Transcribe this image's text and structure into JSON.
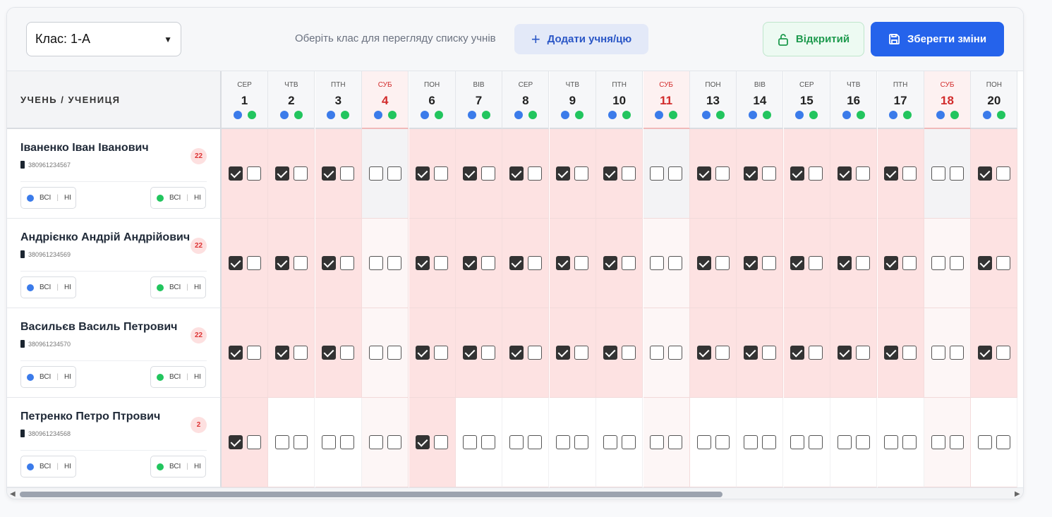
{
  "toolbar": {
    "class_select_value": "Клас: 1-А",
    "hint": "Оберіть клас для перегляду списку учнів",
    "add_label": "Додати учня/цю",
    "open_label": "Відкритий",
    "save_label": "Зберегти зміни"
  },
  "table": {
    "student_header": "УЧЕНЬ / УЧЕНИЦЯ",
    "days": [
      {
        "dow": "СЕР",
        "num": "1",
        "weekend": false
      },
      {
        "dow": "ЧТВ",
        "num": "2",
        "weekend": false
      },
      {
        "dow": "ПТН",
        "num": "3",
        "weekend": false
      },
      {
        "dow": "СУБ",
        "num": "4",
        "weekend": true
      },
      {
        "dow": "ПОН",
        "num": "6",
        "weekend": false
      },
      {
        "dow": "ВІВ",
        "num": "7",
        "weekend": false
      },
      {
        "dow": "СЕР",
        "num": "8",
        "weekend": false
      },
      {
        "dow": "ЧТВ",
        "num": "9",
        "weekend": false
      },
      {
        "dow": "ПТН",
        "num": "10",
        "weekend": false
      },
      {
        "dow": "СУБ",
        "num": "11",
        "weekend": true
      },
      {
        "dow": "ПОН",
        "num": "13",
        "weekend": false
      },
      {
        "dow": "ВІВ",
        "num": "14",
        "weekend": false
      },
      {
        "dow": "СЕР",
        "num": "15",
        "weekend": false
      },
      {
        "dow": "ЧТВ",
        "num": "16",
        "weekend": false
      },
      {
        "dow": "ПТН",
        "num": "17",
        "weekend": false
      },
      {
        "dow": "СУБ",
        "num": "18",
        "weekend": true
      },
      {
        "dow": "ПОН",
        "num": "20",
        "weekend": false
      }
    ],
    "chip_all": "ВСІ",
    "chip_none": "НІ",
    "students": [
      {
        "name": "Іваненко Іван Іванович",
        "phone": "380961234567",
        "count": "22",
        "checks": [
          1,
          1,
          1,
          0,
          1,
          1,
          1,
          1,
          1,
          0,
          1,
          1,
          1,
          1,
          1,
          0,
          1
        ]
      },
      {
        "name": "Андрієнко Андрій Андрійович",
        "phone": "380961234569",
        "count": "22",
        "checks": [
          1,
          1,
          1,
          0,
          1,
          1,
          1,
          1,
          1,
          0,
          1,
          1,
          1,
          1,
          1,
          0,
          1
        ]
      },
      {
        "name": "Васильєв Василь Петрович",
        "phone": "380961234570",
        "count": "22",
        "checks": [
          1,
          1,
          1,
          0,
          1,
          1,
          1,
          1,
          1,
          0,
          1,
          1,
          1,
          1,
          1,
          0,
          1
        ]
      },
      {
        "name": "Петренко Петро Птрович",
        "phone": "380961234568",
        "count": "2",
        "checks": [
          1,
          0,
          0,
          0,
          1,
          0,
          0,
          0,
          0,
          0,
          0,
          0,
          0,
          0,
          0,
          0,
          0
        ]
      }
    ]
  },
  "colors": {
    "accent": "#2563eb",
    "breakfast_dot": "#3b7bea",
    "lunch_dot": "#22c55e",
    "weekend_text": "#d22b2b",
    "checked_cell": "#fde2e2"
  }
}
